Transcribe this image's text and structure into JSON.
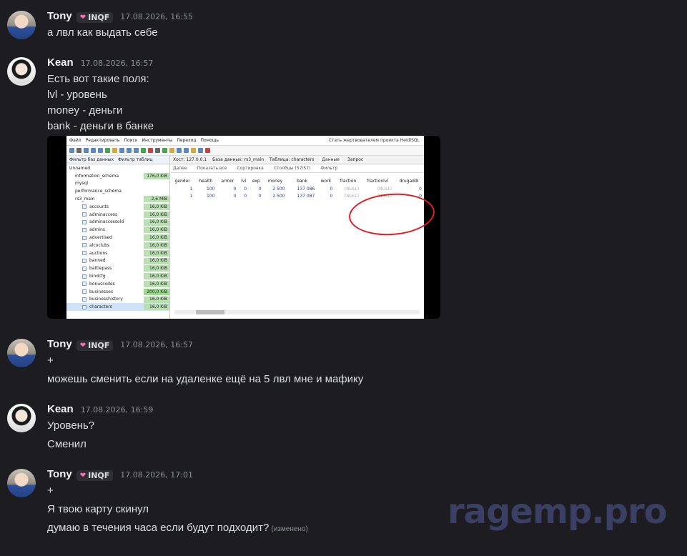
{
  "messages": [
    {
      "author": "Tony",
      "tag": "INQF",
      "time": "17.08.2026, 16:55",
      "lines": [
        "а лвл как выдать себе"
      ]
    },
    {
      "author": "Kean",
      "time": "17.08.2026, 16:57",
      "lines": [
        "Есть вот такие поля:",
        "lvl - уровень",
        "money - деньги",
        "bank - деньги в банке"
      ]
    },
    {
      "author": "Tony",
      "tag": "INQF",
      "time": "17.08.2026, 16:57",
      "lines": [
        "+",
        "можешь сменить если на удаленке ещё на 5 лвл мне и мафику"
      ]
    },
    {
      "author": "Kean",
      "time": "17.08.2026, 16:59",
      "lines": [
        "Уровень?",
        "Сменил"
      ]
    },
    {
      "author": "Tony",
      "tag": "INQF",
      "time": "17.08.2026, 17:01",
      "lines": [
        "+",
        "Я твою карту скинул",
        "думаю в течения часа если будут подходит?"
      ],
      "edited": "(изменено)"
    }
  ],
  "screenshot": {
    "menu": [
      "Файл",
      "Редактировать",
      "Поиск",
      "Инструменты",
      "Переход",
      "Помощь"
    ],
    "donate": "Стать жертвователем проекта HeidiSQL",
    "tree_filters": [
      "Фильтр баз данных",
      "Фильтр таблиц"
    ],
    "tabs": [
      "Хост: 127.0.0.1",
      "База данных: rs3_main",
      "Таблица: characters",
      "Данные",
      "Запрос"
    ],
    "filters": [
      "Далее",
      "Показать все",
      "Сортировка",
      "Столбцы (57/57)",
      "Фильтр"
    ],
    "tree": [
      {
        "name": "Unnamed",
        "size": ""
      },
      {
        "name": "information_schema",
        "size": "176,0 KiB"
      },
      {
        "name": "mysql",
        "size": ""
      },
      {
        "name": "performance_schema",
        "size": ""
      },
      {
        "name": "rs3_main",
        "size": "2,6 MiB"
      },
      {
        "name": "accounts",
        "size": "16,0 KiB"
      },
      {
        "name": "adminaccess",
        "size": "16,0 KiB"
      },
      {
        "name": "adminaccessold",
        "size": "16,0 KiB"
      },
      {
        "name": "admins",
        "size": "16,0 KiB"
      },
      {
        "name": "advertised",
        "size": "16,0 KiB"
      },
      {
        "name": "alcoclubs",
        "size": "16,0 KiB"
      },
      {
        "name": "auctions",
        "size": "16,0 KiB"
      },
      {
        "name": "banned",
        "size": "16,0 KiB"
      },
      {
        "name": "battlepass",
        "size": "16,0 KiB"
      },
      {
        "name": "bindcfg",
        "size": "16,0 KiB"
      },
      {
        "name": "bonuscodes",
        "size": "16,0 KiB"
      },
      {
        "name": "businesses",
        "size": "200,0 KiB"
      },
      {
        "name": "businesshistory",
        "size": "16,0 KiB"
      },
      {
        "name": "characters",
        "size": "16,0 KiB"
      }
    ],
    "columns": [
      "gender",
      "health",
      "armor",
      "lvl",
      "exp",
      "money",
      "bank",
      "work",
      "fraction",
      "fractionlvl",
      "drugaddi"
    ],
    "rows": [
      [
        "1",
        "100",
        "0",
        "0",
        "0",
        "2 500",
        "137 086",
        "0",
        "(NULL)",
        "(NULL)",
        "0"
      ],
      [
        "1",
        "100",
        "0",
        "0",
        "0",
        "2 500",
        "137 087",
        "0",
        "(NULL)",
        "(NULL)",
        "0"
      ]
    ]
  },
  "watermark": "ragemp.pro"
}
